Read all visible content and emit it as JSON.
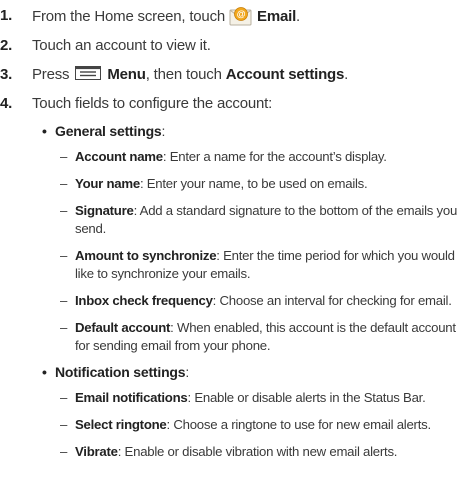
{
  "steps": [
    {
      "num": "1.",
      "pre": "From the Home screen, touch",
      "bold": "Email",
      "post": "."
    },
    {
      "num": "2.",
      "text": "Touch an account to view it."
    },
    {
      "num": "3.",
      "pre": "Press",
      "bold": "Menu",
      "mid": ", then touch ",
      "bold2": "Account settings",
      "post": "."
    },
    {
      "num": "4.",
      "text": "Touch fields to configure the account:"
    }
  ],
  "sections": [
    {
      "bullet": "•",
      "title": "General settings",
      "colon": ":",
      "items": [
        {
          "dash": "–",
          "term": "Account name",
          "desc": ": Enter a name for the account’s display."
        },
        {
          "dash": "–",
          "term": "Your name",
          "desc": ": Enter your name, to be used on emails."
        },
        {
          "dash": "–",
          "term": "Signature",
          "desc": ": Add a standard signature to the bottom of the emails you",
          "desc2": "send."
        },
        {
          "dash": "–",
          "term": "Amount to synchronize",
          "desc": ": Enter the time period for which you would",
          "desc2": "like to synchronize your emails."
        },
        {
          "dash": "–",
          "term": "Inbox check frequency",
          "desc": ": Choose an interval for checking for email."
        },
        {
          "dash": "–",
          "term": "Default account",
          "desc": ": When enabled, this account is the default account",
          "desc2": "for sending email from your phone."
        }
      ]
    },
    {
      "bullet": "•",
      "title": "Notification settings",
      "colon": ":",
      "items": [
        {
          "dash": "–",
          "term": "Email notifications",
          "desc": ": Enable or disable alerts in the Status Bar."
        },
        {
          "dash": "–",
          "term": "Select ringtone",
          "desc": ": Choose a ringtone to use for new email alerts."
        },
        {
          "dash": "–",
          "term": "Vibrate",
          "desc": ": Enable or disable vibration with new email alerts."
        }
      ]
    }
  ],
  "icons": {
    "email": "email-app-icon",
    "menu": "menu-key-icon"
  },
  "colors": {
    "text": "#3a3a3a",
    "bold": "#222222",
    "email_icon_envelope": "#f5f1e6",
    "email_icon_badge": "#f2a81d"
  }
}
